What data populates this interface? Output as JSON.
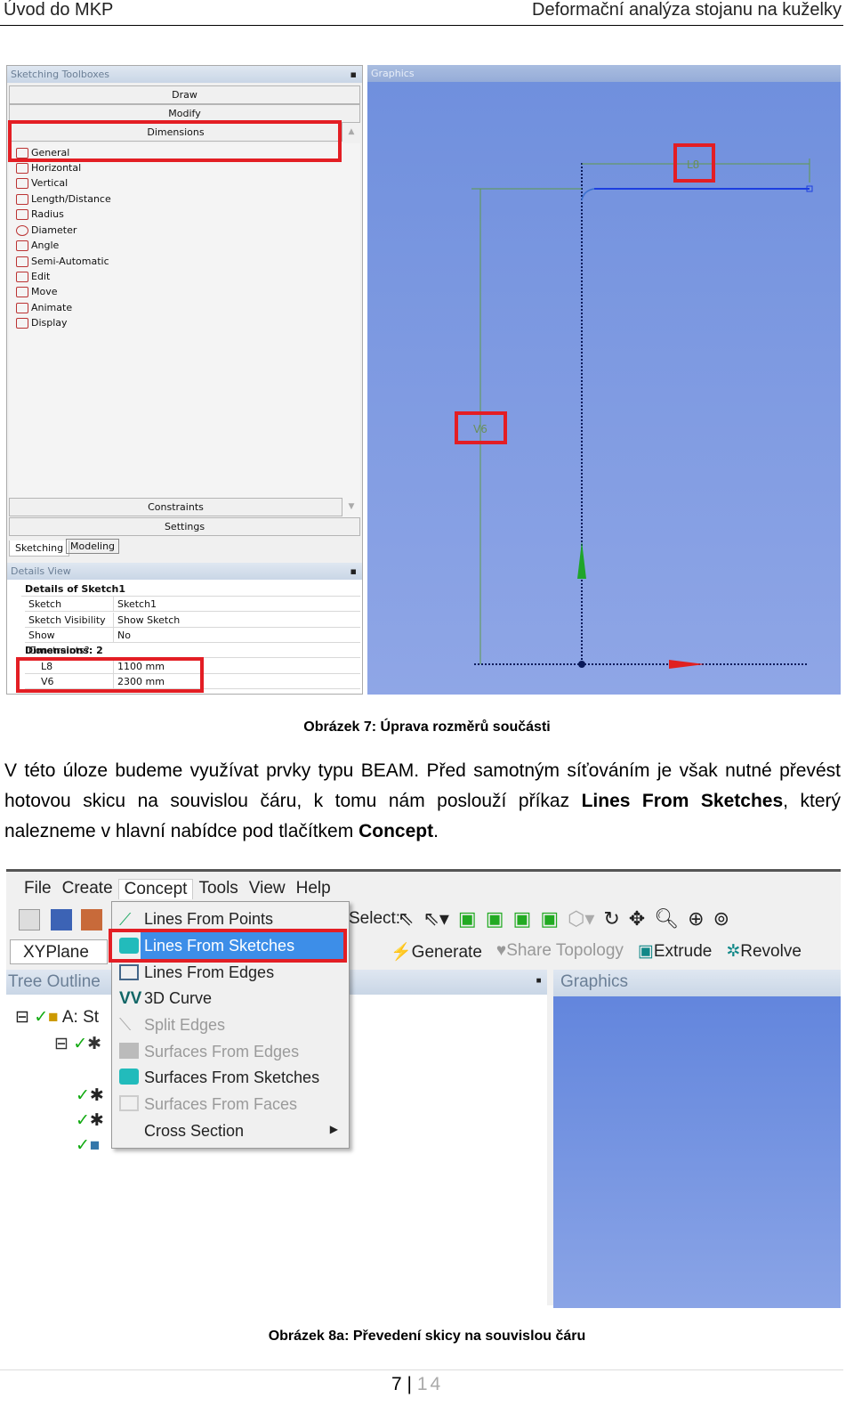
{
  "header": {
    "left": "Úvod do MKP",
    "right": "Deformační analýza stojanu na kuželky"
  },
  "figure7": {
    "toolbox": {
      "title": "Sketching Toolboxes",
      "sections": [
        "Draw",
        "Modify",
        "Dimensions"
      ],
      "tools": [
        "General",
        "Horizontal",
        "Vertical",
        "Length/Distance",
        "Radius",
        "Diameter",
        "Angle",
        "Semi-Automatic",
        "Edit",
        "Move",
        "Animate",
        "Display"
      ],
      "bottom_sections": [
        "Constraints",
        "Settings"
      ],
      "tabs": [
        "Sketching",
        "Modeling"
      ]
    },
    "details": {
      "title": "Details View",
      "group1": "Details of Sketch1",
      "rows": [
        {
          "k": "Sketch",
          "v": "Sketch1"
        },
        {
          "k": "Sketch Visibility",
          "v": "Show Sketch"
        },
        {
          "k": "Show Constraints?",
          "v": "No"
        }
      ],
      "group2": "Dimensions: 2",
      "dims": [
        {
          "k": "L8",
          "v": "1100 mm"
        },
        {
          "k": "V6",
          "v": "2300 mm"
        }
      ]
    },
    "graphics": {
      "title": "Graphics",
      "dim_h": "L8",
      "dim_v": "V6"
    },
    "caption": "Obrázek 7: Úprava rozměrů součásti"
  },
  "paragraph": {
    "t1": "V této úloze budeme využívat prvky typu BEAM. Před samotným síťováním je však nutné převést hotovou skicu na souvislou čáru, k tomu nám poslouží příkaz ",
    "b1": "Lines From Sketches",
    "t2": ", který nalezneme v hlavní nabídce pod tlačítkem ",
    "b2": "Concept",
    "t3": "."
  },
  "figure8": {
    "menubar": [
      "File",
      "Create",
      "Concept",
      "Tools",
      "View",
      "Help"
    ],
    "menu_items": [
      {
        "label": "Lines From Points",
        "enabled": true
      },
      {
        "label": "Lines From Sketches",
        "enabled": true,
        "highlighted": true
      },
      {
        "label": "Lines From Edges",
        "enabled": true
      },
      {
        "label": "3D Curve",
        "enabled": true
      },
      {
        "label": "Split Edges",
        "enabled": false
      },
      {
        "label": "Surfaces From Edges",
        "enabled": false
      },
      {
        "label": "Surfaces From Sketches",
        "enabled": true
      },
      {
        "label": "Surfaces From Faces",
        "enabled": false
      },
      {
        "label": "Cross Section",
        "enabled": true,
        "submenu": true
      }
    ],
    "select_label": "Select:",
    "plane": "XYPlane",
    "generate": "Generate",
    "share_topology": "Share Topology",
    "extrude": "Extrude",
    "revolve": "Revolve",
    "tree_title": "Tree Outline",
    "tree_root": "A: St",
    "graphics_title": "Graphics",
    "caption": "Obrázek 8a: Převedení skicy na souvislou čáru"
  },
  "footer": {
    "page": "7",
    "total": "14"
  },
  "colors": {
    "highlight_red": "#e31e24",
    "graphics_blue": "#7b9ae0",
    "menu_highlight": "#3d8ee8"
  }
}
